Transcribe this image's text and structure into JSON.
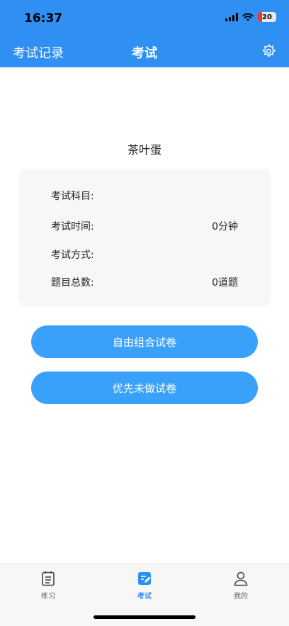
{
  "status_bar": {
    "time": "16:37",
    "battery": "20"
  },
  "nav": {
    "left_label": "考试记录",
    "title": "考试",
    "settings_icon": "gear-icon"
  },
  "exam": {
    "name": "茶叶蛋",
    "rows": [
      {
        "label": "考试科目:",
        "value": ""
      },
      {
        "label": "考试时间:",
        "value": "0分钟"
      },
      {
        "label": "考试方式:",
        "value": ""
      },
      {
        "label": "题目总数:",
        "value": "0道题"
      }
    ]
  },
  "buttons": {
    "free_combo": "自由组合试卷",
    "undone_first": "优先未做试卷"
  },
  "tabbar": {
    "items": [
      {
        "label": "练习",
        "icon": "notebook-icon"
      },
      {
        "label": "考试",
        "icon": "exam-edit-icon",
        "active": true
      },
      {
        "label": "我的",
        "icon": "person-icon"
      }
    ]
  },
  "colors": {
    "header": "#2f8ff2",
    "button": "#3aa1fb",
    "tab_active": "#2f8ff2"
  }
}
